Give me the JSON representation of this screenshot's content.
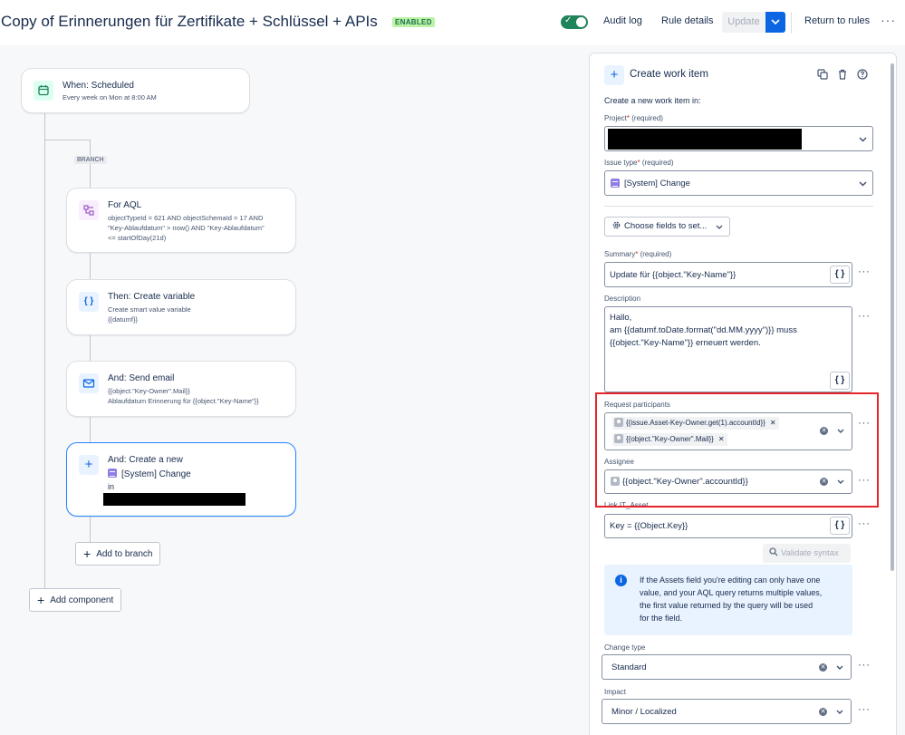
{
  "header": {
    "title": "Copy of Erinnerungen für Zertifikate + Schlüssel + APIs",
    "status_badge": "ENABLED",
    "audit_log": "Audit log",
    "rule_details": "Rule details",
    "update": "Update",
    "return_to_rules": "Return to rules",
    "more": "···"
  },
  "canvas": {
    "trigger": {
      "title": "When: Scheduled",
      "subtitle": "Every week on Mon at 8:00 AM"
    },
    "branch_tag": "BRANCH",
    "for_aql": {
      "title": "For AQL",
      "line1": "objectTypeId = 621 AND objectSchemaId = 17 AND",
      "line2": "\"Key-Ablaufdatum\" > now() AND \"Key-Ablaufdatum\"",
      "line3": "<= startOfDay(21d)"
    },
    "create_variable": {
      "title": "Then: Create variable",
      "line1": "Create smart value variable",
      "line2": "{{datumf}}"
    },
    "send_email": {
      "title": "And: Send email",
      "line1": "{{object.\"Key-Owner\".Mail}}",
      "line2": "Ablaufdatum Erinnerung für {{object.\"Key-Name\"}}"
    },
    "create_new": {
      "title": "And: Create a new",
      "type": "[System] Change",
      "in": "in"
    },
    "add_to_branch": "Add to branch",
    "add_component": "Add component"
  },
  "panel": {
    "title": "Create work item",
    "intro": "Create a new work item in:",
    "project_label": "Project",
    "required": "(required)",
    "issue_type_label": "Issue type",
    "issue_type_value": "[System] Change",
    "choose_fields": "Choose fields to set...",
    "summary_label": "Summary",
    "summary_value": "Update für {{object.\"Key-Name\"}}",
    "description_label": "Description",
    "description_lines": [
      "Hallo,",
      "am {{datumf.toDate.format(\"dd.MM.yyyy\")}} muss",
      "{{object.\"Key-Name\"}} erneuert werden."
    ],
    "request_participants_label": "Request participants",
    "participants": [
      "{{issue.Asset-Key-Owner.get(1).accountId}}",
      "{{object.\"Key-Owner\".Mail}}"
    ],
    "assignee_label": "Assignee",
    "assignee_value": "{{object.\"Key-Owner\".accountId}}",
    "link_asset_label": "Link IT_Asset",
    "link_asset_value": "Key = {{Object.Key}}",
    "validate_syntax": "Validate syntax",
    "info_text": [
      "If the Assets field you're editing can only have one",
      "value, and your AQL query returns multiple values,",
      "the first value returned by the query will be used",
      "for the field."
    ],
    "change_type_label": "Change type",
    "change_type_value": "Standard",
    "impact_label": "Impact",
    "impact_value": "Minor / Localized",
    "curly_icon": "{ }",
    "more": "···"
  },
  "colors": {
    "accent": "#0c66e4",
    "enabled_green": "#1f845a",
    "highlight_red": "#e5252a"
  }
}
